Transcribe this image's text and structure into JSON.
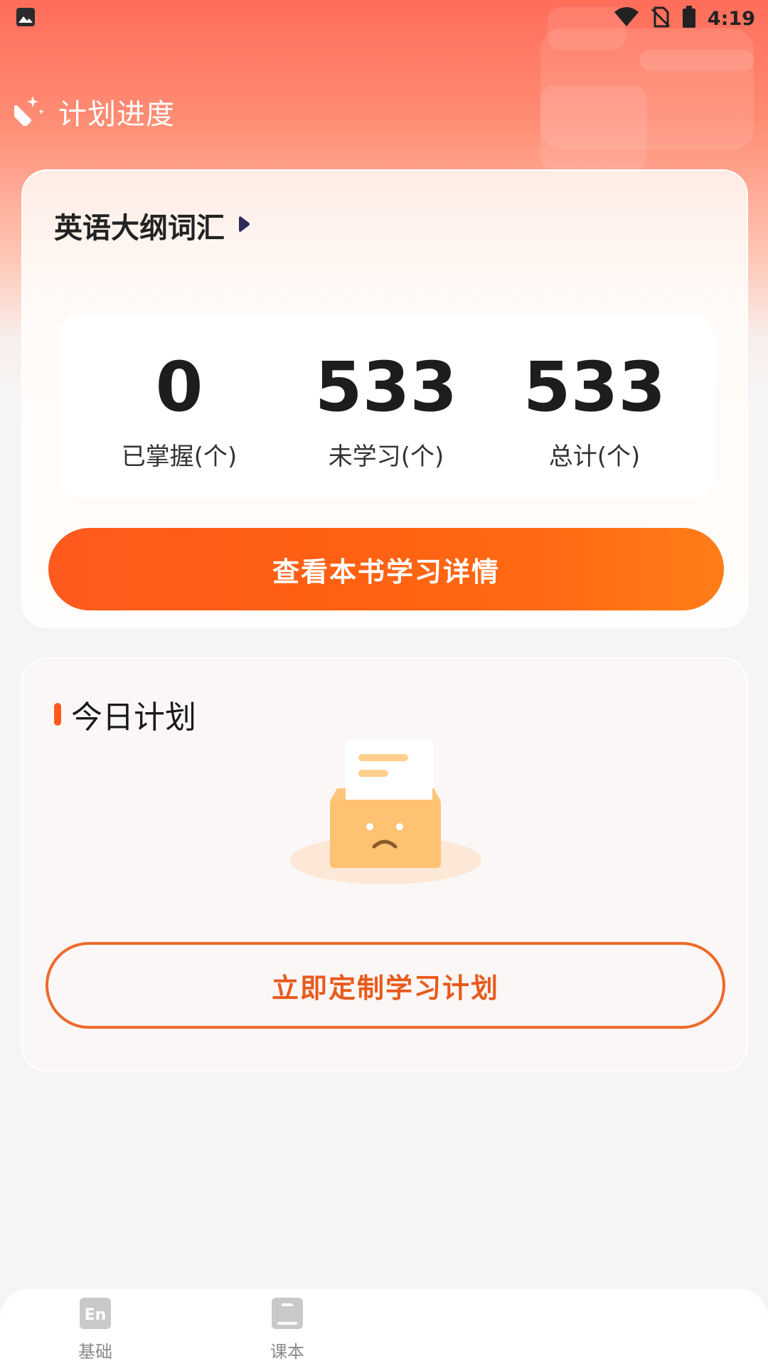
{
  "status_bar": {
    "time": "4:19",
    "icons": [
      "image-icon",
      "wifi-icon",
      "no-sim-icon",
      "battery-icon"
    ]
  },
  "header": {
    "icon": "magic-wand-icon",
    "title": "计划进度"
  },
  "progress_card": {
    "book_title": "英语大纲词汇",
    "stats": [
      {
        "value": "0",
        "label": "已掌握(个)"
      },
      {
        "value": "533",
        "label": "未学习(个)"
      },
      {
        "value": "533",
        "label": "总计(个)"
      }
    ],
    "detail_button": "查看本书学习详情"
  },
  "plan_card": {
    "title": "今日计划",
    "empty_icon": "empty-box-icon",
    "create_button": "立即定制学习计划"
  },
  "bottom_nav": {
    "items": [
      {
        "label": "基础",
        "icon": "en-icon",
        "icon_text": "En"
      },
      {
        "label": "课本",
        "icon": "book-icon"
      }
    ]
  },
  "colors": {
    "accent": "#ff5a1e",
    "hero_top": "#ff6d5a",
    "outline_button": "#ee6a2a",
    "background": "#f6f5f6"
  }
}
